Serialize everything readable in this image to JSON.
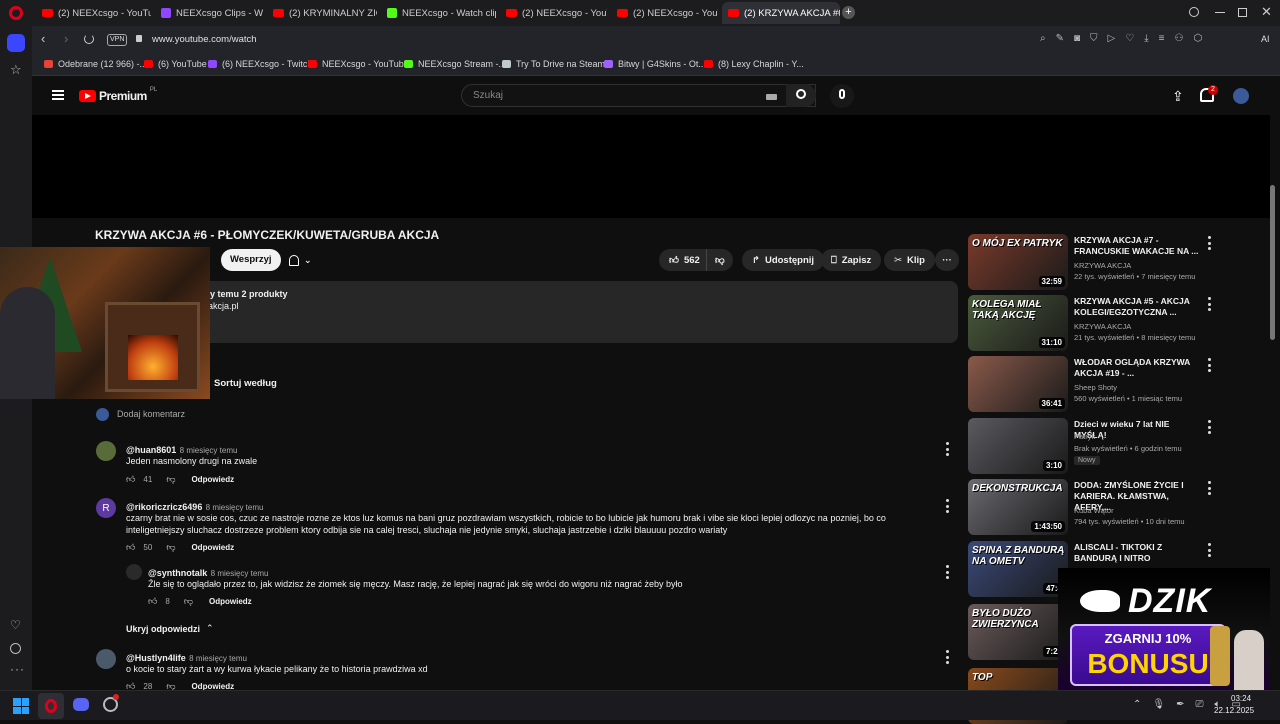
{
  "browser": {
    "tabs": [
      {
        "label": "(2) NEEXcsgo - YouTube",
        "icon": "youtube"
      },
      {
        "label": "NEEXcsgo Clips - Watch L",
        "icon": "twitch"
      },
      {
        "label": "(2) KRYMINALNY ZIOMEK",
        "icon": "youtube"
      },
      {
        "label": "NEEXcsgo - Watch clips o",
        "icon": "kick"
      },
      {
        "label": "(2) NEEXcsgo - YouTube",
        "icon": "youtube"
      },
      {
        "label": "(2) NEEXcsgo - YouTube",
        "icon": "youtube"
      },
      {
        "label": "(2) KRZYWA AKCJA #6 - P",
        "icon": "youtube",
        "active": true
      }
    ],
    "vpn_label": "VPN",
    "url": "www.youtube.com/watch",
    "ai_label": "AI",
    "bookmarks": [
      {
        "label": "Odebrane (12 966) -...",
        "icon": "gmail"
      },
      {
        "label": "(6) YouTube",
        "icon": "youtube"
      },
      {
        "label": "(6) NEEXcsgo - Twitch",
        "icon": "twitch"
      },
      {
        "label": "NEEXcsgo - YouTube",
        "icon": "youtube"
      },
      {
        "label": "NEEXcsgo Stream -...",
        "icon": "kick"
      },
      {
        "label": "Try To Drive na Steam",
        "icon": "steam"
      },
      {
        "label": "Bitwy | G4Skins - Ot...",
        "icon": "g4skins"
      },
      {
        "label": "(8) Lexy Chaplin - Y...",
        "icon": "youtube"
      }
    ]
  },
  "yt": {
    "logo_text": "Premium",
    "logo_region": "PL",
    "search_placeholder": "Szukaj",
    "notif_count": "2",
    "video_title": "KRZYWA AKCJA #6 - PŁOMYCZEK/KUWETA/GRUBA AKCJA",
    "support_label": "Wesprzyj",
    "likes": "562",
    "share_label": "Udostępnij",
    "save_label": "Zapisz",
    "clip_label": "Klip",
    "desc_line1": "cy temu  2 produkty",
    "desc_line2": "-akcja.pl",
    "sort_label": "Sortuj według",
    "add_comment": "Dodaj komentarz",
    "reply_label": "Odpowiedz",
    "hide_replies": "Ukryj odpowiedzi"
  },
  "comments": [
    {
      "name": "@huan8601",
      "time": "8 miesięcy temu",
      "text": "Jeden nasmolony drugi na zwale",
      "likes": "41",
      "avatar_color": "#5a6b3a"
    },
    {
      "name": "@rikoriczricz6496",
      "time": "8 miesięcy temu",
      "text": "czarny brat nie w sosie cos, czuc ze nastroje rozne ze ktos luz komus na bani gruz pozdrawiam wszystkich, robicie to bo lubicie jak humoru brak i vibe sie kloci lepiej odlozyc na pozniej, bo co inteligetniejszy sluchacz dostrzeze problem ktory odbija sie na calej tresci, sluchaja nie jedynie smyki, sluchaja jastrzebie i dziki blauuuu pozdro wariaty",
      "likes": "50",
      "avatar_letter": "R",
      "avatar_color": "#5c3aa0"
    },
    {
      "name": "@synthnotalk",
      "time": "8 miesięcy temu",
      "text": "Źle się to oglądało przez to, jak widzisz że ziomek się męczy. Masz rację, że lepiej nagrać jak się wróci do wigoru niż nagrać żeby było",
      "likes": "8",
      "is_reply": true
    },
    {
      "name": "@Hustlyn4life",
      "time": "8 miesięcy temu",
      "text": "o kocie to stary żart a wy kurwa łykacie pelikany że to historia prawdziwa xd",
      "likes": "28",
      "avatar_color": "#4a5a6a"
    }
  ],
  "recommended": [
    {
      "title": "KRZYWA AKCJA #7 - FRANCUSKIE WAKACJE NA ...",
      "channel": "KRZYWA AKCJA",
      "meta": "22 tys. wyświetleń • 7 miesięcy temu",
      "duration": "32:59",
      "thumb_text": "O MÓJ EX PATRYK",
      "thumb_color": "#7a3a2a"
    },
    {
      "title": "KRZYWA AKCJA #5 - AKCJA KOLEGI/EGZOTYCZNA ...",
      "channel": "KRZYWA AKCJA",
      "meta": "21 tys. wyświetleń • 8 miesięcy temu",
      "duration": "31:10",
      "thumb_text": "KOLEGA MIAŁ TAKĄ AKCJĘ",
      "thumb_color": "#4a5a3a"
    },
    {
      "title": "WŁODAR OGLĄDA KRZYWA AKCJA #19 - ...",
      "channel": "Sheep Shoty",
      "meta": "560 wyświetleń • 1 miesiąc temu",
      "duration": "36:41",
      "thumb_text": "",
      "thumb_color": "#8a5a4a"
    },
    {
      "title": "Dzieci w wieku 7 lat NIE MYŚLĄ!",
      "channel": "Patryk",
      "meta": "Brak wyświetleń • 6 godzin temu",
      "duration": "3:10",
      "badge": "Nowy",
      "thumb_text": "",
      "thumb_color": "#5a5a60"
    },
    {
      "title": "DODA: ZMYŚLONE ŻYCIE I KARIERA. KŁAMSTWA, AFERY,...",
      "channel": "Kuba Wątor",
      "meta": "794 tys. wyświetleń • 10 dni temu",
      "duration": "1:43:50",
      "thumb_text": "DEKONSTRUKCJA",
      "thumb_color": "#6a6a70"
    },
    {
      "title": "ALISCALI - TIKTOKI Z BANDURĄ I NITRO",
      "channel": "",
      "meta": "",
      "duration": "47:4",
      "thumb_text": "SPINA Z BANDURĄ NA OMETV",
      "thumb_color": "#3a4a7a"
    },
    {
      "title": "",
      "channel": "",
      "meta": "",
      "duration": "7:22",
      "thumb_text": "BYŁO DUŻO ZWIERZYNCA",
      "thumb_color": "#6a5a5a"
    },
    {
      "title": "",
      "channel": "",
      "meta": "",
      "duration": "",
      "thumb_text": "TOP",
      "thumb_color": "#8a4a1a"
    }
  ],
  "overlay_ad": {
    "brand": "DZIK",
    "line1": "ZGARNIJ 10%",
    "line2": "BONUSU"
  },
  "taskbar": {
    "time": "03:24",
    "date": "22.12.2025"
  }
}
